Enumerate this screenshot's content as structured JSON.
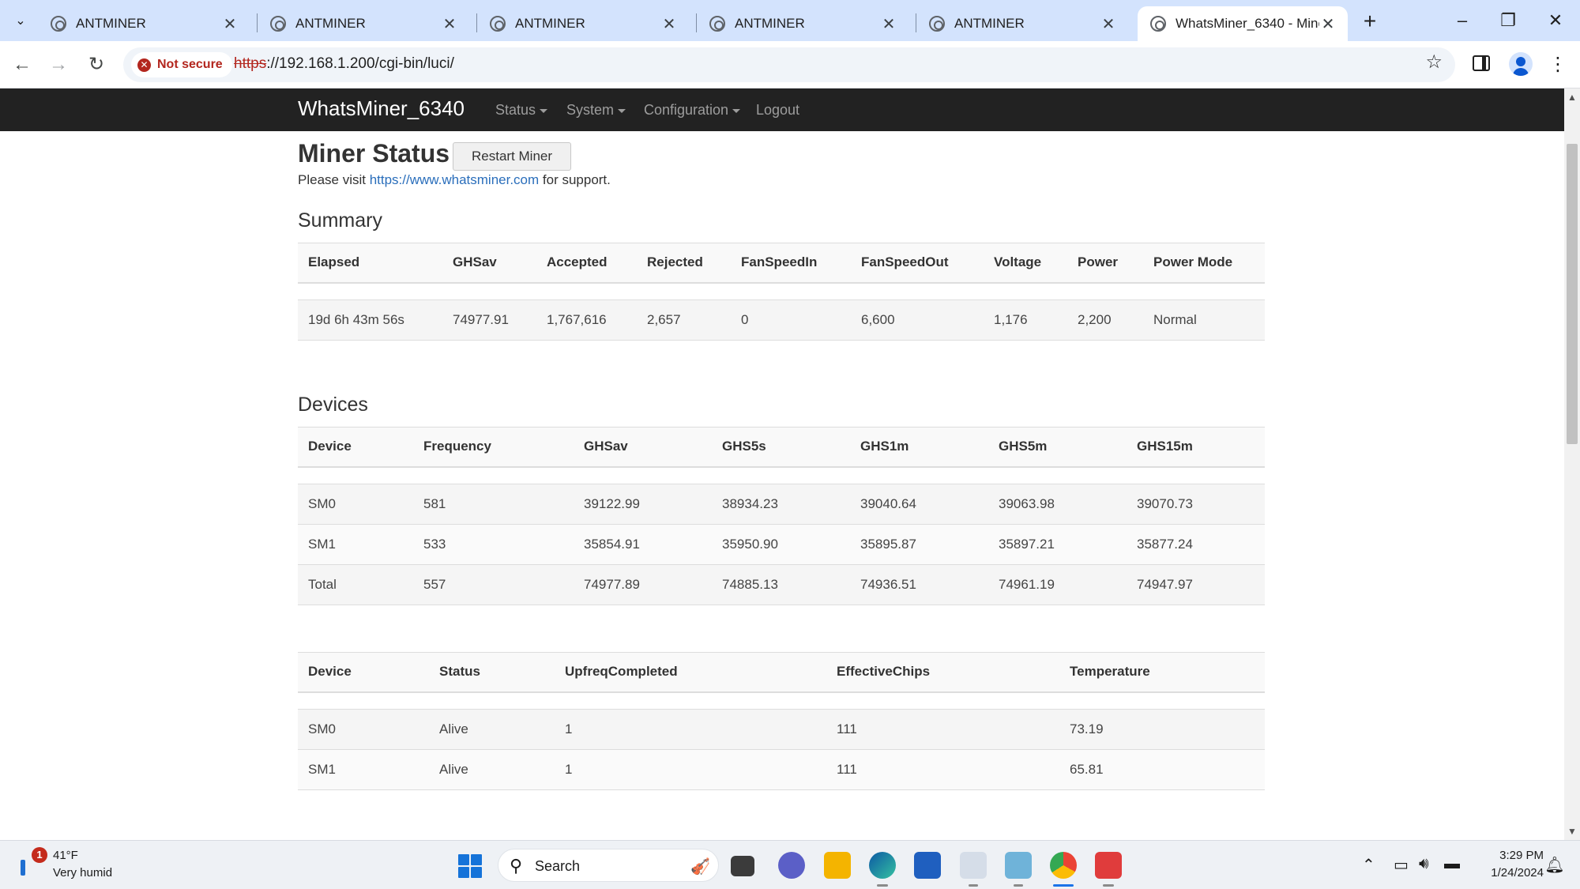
{
  "browser": {
    "tabs": [
      {
        "title": "ANTMINER"
      },
      {
        "title": "ANTMINER"
      },
      {
        "title": "ANTMINER"
      },
      {
        "title": "ANTMINER"
      },
      {
        "title": "ANTMINER"
      },
      {
        "title": "WhatsMiner_6340 - Miner"
      }
    ],
    "security_label": "Not secure",
    "url_scheme": "https",
    "url_rest": "://192.168.1.200/cgi-bin/luci/"
  },
  "nav": {
    "brand": "WhatsMiner_6340",
    "menus": [
      "Status",
      "System",
      "Configuration"
    ],
    "logout": "Logout"
  },
  "page": {
    "title": "Miner Status",
    "restart_label": "Restart Miner",
    "support_prefix": "Please visit ",
    "support_link": "https://www.whatsminer.com",
    "support_suffix": " for support.",
    "summary_heading": "Summary",
    "devices_heading": "Devices"
  },
  "summary": {
    "headers": [
      "Elapsed",
      "GHSav",
      "Accepted",
      "Rejected",
      "FanSpeedIn",
      "FanSpeedOut",
      "Voltage",
      "Power",
      "Power Mode"
    ],
    "row": [
      "19d 6h 43m 56s",
      "74977.91",
      "1,767,616",
      "2,657",
      "0",
      "6,600",
      "1,176",
      "2,200",
      "Normal"
    ]
  },
  "devices": {
    "headers": [
      "Device",
      "Frequency",
      "GHSav",
      "GHS5s",
      "GHS1m",
      "GHS5m",
      "GHS15m"
    ],
    "rows": [
      [
        "SM0",
        "581",
        "39122.99",
        "38934.23",
        "39040.64",
        "39063.98",
        "39070.73"
      ],
      [
        "SM1",
        "533",
        "35854.91",
        "35950.90",
        "35895.87",
        "35897.21",
        "35877.24"
      ],
      [
        "Total",
        "557",
        "74977.89",
        "74885.13",
        "74936.51",
        "74961.19",
        "74947.97"
      ]
    ]
  },
  "device_status": {
    "headers": [
      "Device",
      "Status",
      "UpfreqCompleted",
      "EffectiveChips",
      "Temperature"
    ],
    "rows": [
      [
        "SM0",
        "Alive",
        "1",
        "111",
        "73.19"
      ],
      [
        "SM1",
        "Alive",
        "1",
        "111",
        "65.81"
      ]
    ]
  },
  "taskbar": {
    "weather_badge": "1",
    "weather_temp": "41°F",
    "weather_desc": "Very humid",
    "search_label": "Search",
    "time": "3:29 PM",
    "date": "1/24/2024"
  }
}
